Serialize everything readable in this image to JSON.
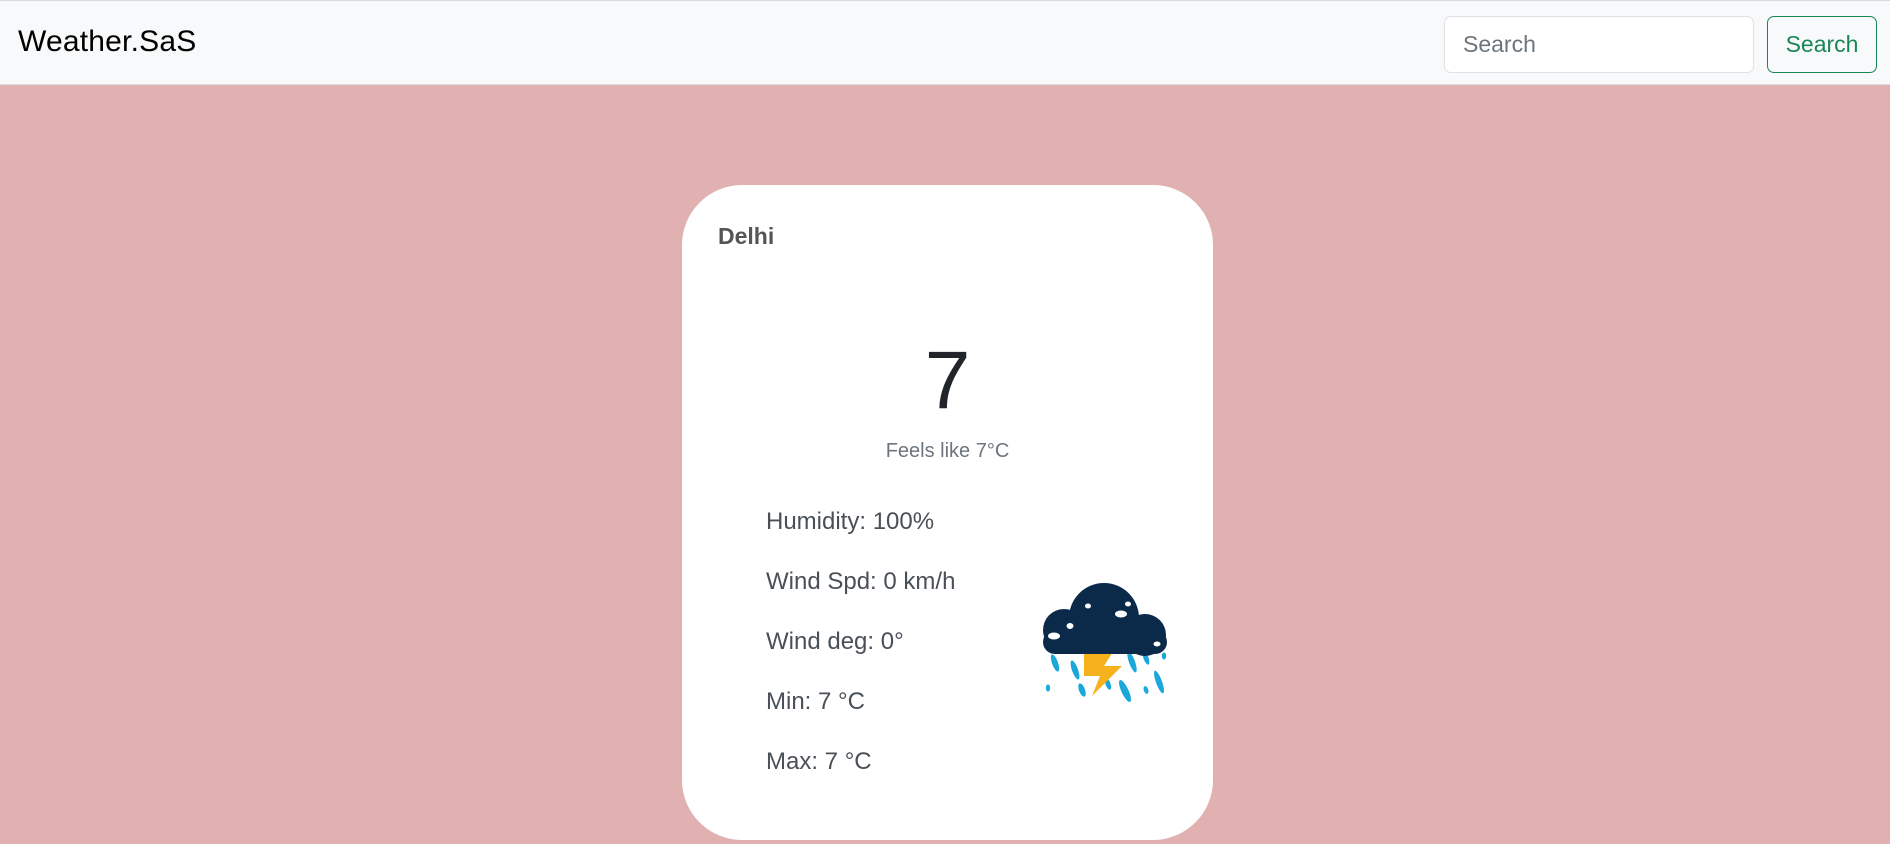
{
  "brand": "Weather.SaS",
  "search": {
    "placeholder": "Search",
    "button_label": "Search"
  },
  "card": {
    "city": "Delhi",
    "temperature": "7",
    "feels_like": "Feels like 7°C",
    "humidity": "Humidity: 100%",
    "wind_speed": "Wind Spd: 0 km/h",
    "wind_deg": "Wind deg: 0°",
    "min": "Min: 7 °C",
    "max": "Max: 7 °C",
    "icon": "thunderstorm-cloud-icon"
  },
  "colors": {
    "page_background": "#e1b0b1",
    "navbar_background": "#f8f9fa",
    "accent_green": "#198754",
    "cloud": "#0b2a4a",
    "rain": "#1aa7d9",
    "lightning": "#f5b21c"
  }
}
